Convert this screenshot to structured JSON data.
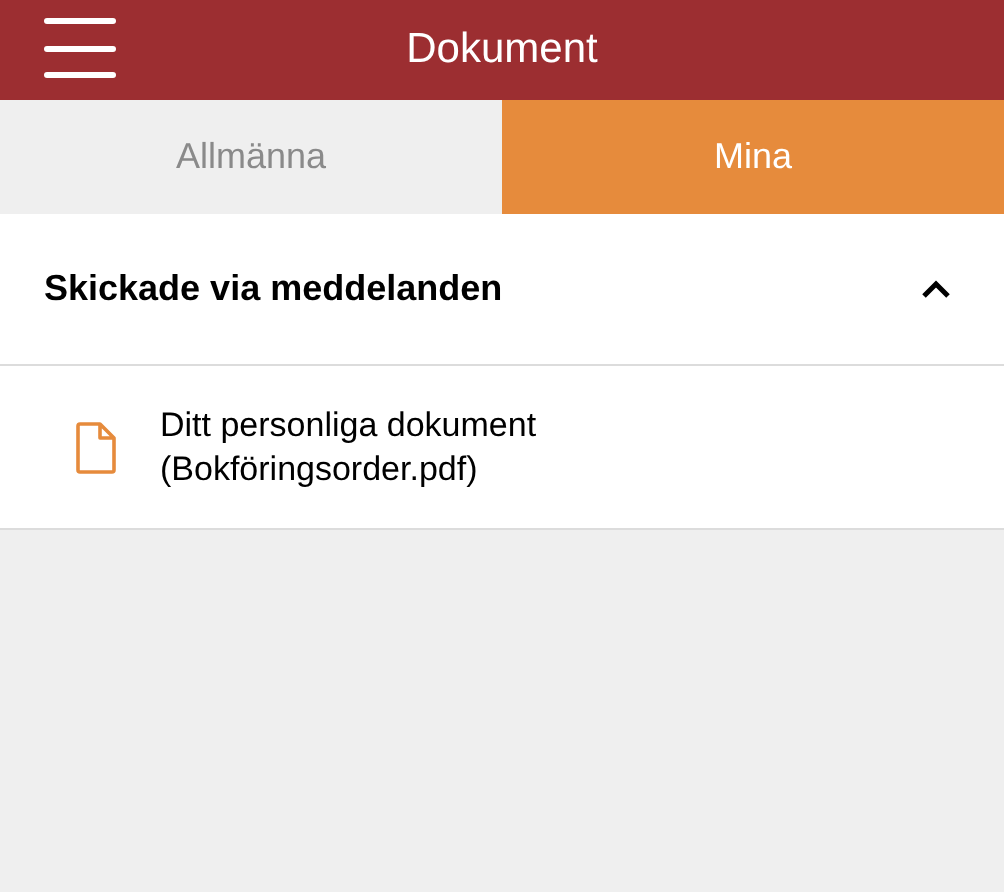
{
  "header": {
    "title": "Dokument"
  },
  "tabs": [
    {
      "label": "Allmänna",
      "selected": false
    },
    {
      "label": "Mina",
      "selected": true
    }
  ],
  "section": {
    "title": "Skickade via meddelanden",
    "expanded": true,
    "items": [
      {
        "label": "Ditt personliga dokument (Bokföringsorder.pdf)"
      }
    ]
  }
}
